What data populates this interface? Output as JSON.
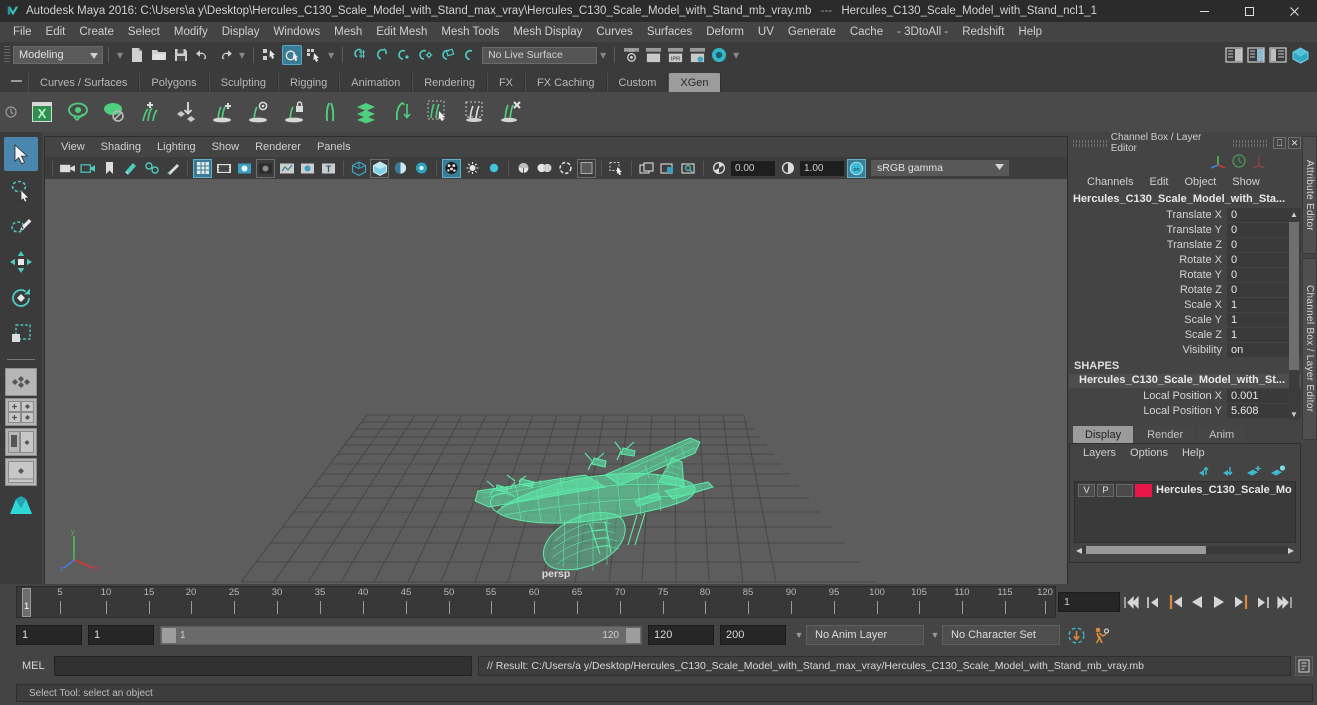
{
  "titlebar": {
    "app_title": "Autodesk Maya 2016: C:\\Users\\a y\\Desktop\\Hercules_C130_Scale_Model_with_Stand_max_vray\\Hercules_C130_Scale_Model_with_Stand_mb_vray.mb",
    "separator": "---",
    "selection_title": "Hercules_C130_Scale_Model_with_Stand_ncl1_1",
    "minimize": "─",
    "maximize": "❐",
    "close": "✕",
    "logo_icon": "maya-logo-icon"
  },
  "menubar": {
    "items": [
      "File",
      "Edit",
      "Create",
      "Select",
      "Modify",
      "Display",
      "Windows",
      "Mesh",
      "Edit Mesh",
      "Mesh Tools",
      "Mesh Display",
      "Curves",
      "Surfaces",
      "Deform",
      "UV",
      "Generate",
      "Cache",
      "- 3DtoAll -",
      "Redshift",
      "Help"
    ]
  },
  "statusbar": {
    "mode": "Modeling",
    "live_surface": "No Live Surface",
    "icons": [
      "new-scene-icon",
      "open-scene-icon",
      "save-scene-icon",
      "undo-icon",
      "redo-icon",
      "select-hierarchy-icon",
      "select-object-icon",
      "select-component-icon",
      "snap-to-grid-icon",
      "snap-to-curve-icon",
      "snap-to-point-icon",
      "snap-to-projected-center-icon",
      "snap-to-view-plane-icon",
      "make-live-icon"
    ],
    "right_icons": [
      "render-view-icon",
      "render-sequence-icon",
      "ipr-render-icon",
      "render-settings-icon",
      "hypershade-icon"
    ],
    "render_icons": [
      "render-current-frame-icon",
      "render-region-icon",
      "ipr-icon",
      "render-settings-icon",
      "toggle-icon"
    ]
  },
  "shelf": {
    "tabs": [
      "Curves / Surfaces",
      "Polygons",
      "Sculpting",
      "Rigging",
      "Animation",
      "Rendering",
      "FX",
      "FX Caching",
      "Custom",
      "XGen"
    ],
    "active_tab": "XGen",
    "icons": [
      "xgen-editor-icon",
      "xgen-preview-icon",
      "xgen-disable-preview-icon",
      "xgen-add-description-icon",
      "xgen-import-icon",
      "xgen-add-primitive-icon",
      "xgen-preview-primitive-icon",
      "xgen-lock-icon",
      "xgen-groom-brush-icon",
      "xgen-layers-icon",
      "xgen-comb-icon",
      "xgen-select-guides-icon",
      "xgen-region-icon",
      "xgen-delete-icon"
    ]
  },
  "toolbox": {
    "tools": [
      {
        "name": "select-tool",
        "active": true
      },
      {
        "name": "lasso-select-tool",
        "active": false
      },
      {
        "name": "paint-select-tool",
        "active": false
      },
      {
        "name": "move-tool",
        "active": false
      },
      {
        "name": "rotate-tool",
        "active": false
      },
      {
        "name": "scale-tool",
        "active": false
      }
    ],
    "layout_icons": [
      "layout-single-perspective-icon",
      "layout-four-view-icon",
      "layout-outliner-persp-icon",
      "layout-persp-graph-icon",
      "layout-hypershade-icon"
    ]
  },
  "viewport": {
    "menus": [
      "View",
      "Shading",
      "Lighting",
      "Show",
      "Renderer",
      "Panels"
    ],
    "camera_label": "persp",
    "exposure": "0.00",
    "gamma": "1.00",
    "color_profile": "sRGB gamma",
    "color_mgmt_toggle": "on",
    "toolbar_icons": [
      "select-camera-icon",
      "lock-camera-icon",
      "bookmark-icon",
      "image-plane-icon",
      "2d-pan-zoom-icon",
      "grease-pencil-icon",
      "grid-toggle-icon",
      "film-gate-icon",
      "resolution-gate-icon",
      "gate-mask-icon",
      "xray-icon",
      "xray-joints-icon",
      "texture-border-icon",
      "wireframe-shaded-icon",
      "smooth-shaded-icon",
      "shaded-textured-icon",
      "lighting-icon",
      "shadows-icon",
      "ao-icon",
      "motion-blur-icon",
      "multisample-icon",
      "isolate-select-icon",
      "panel-tearoff-icon",
      "panel-copy-icon",
      "panel-search-icon"
    ]
  },
  "channel_box": {
    "title": "Channel Box / Layer Editor",
    "menus": [
      "Channels",
      "Edit",
      "Object",
      "Show"
    ],
    "object_name": "Hercules_C130_Scale_Model_with_Sta...",
    "attributes": [
      {
        "label": "Translate X",
        "value": "0"
      },
      {
        "label": "Translate Y",
        "value": "0"
      },
      {
        "label": "Translate Z",
        "value": "0"
      },
      {
        "label": "Rotate X",
        "value": "0"
      },
      {
        "label": "Rotate Y",
        "value": "0"
      },
      {
        "label": "Rotate Z",
        "value": "0"
      },
      {
        "label": "Scale X",
        "value": "1"
      },
      {
        "label": "Scale Y",
        "value": "1"
      },
      {
        "label": "Scale Z",
        "value": "1"
      },
      {
        "label": "Visibility",
        "value": "on"
      }
    ],
    "shapes_header": "SHAPES",
    "shape_name": "Hercules_C130_Scale_Model_with_St...",
    "shape_attributes": [
      {
        "label": "Local Position X",
        "value": "0.001"
      },
      {
        "label": "Local Position Y",
        "value": "5.608"
      }
    ]
  },
  "layer_editor": {
    "tabs": [
      "Display",
      "Render",
      "Anim"
    ],
    "active_tab": "Display",
    "menus": [
      "Layers",
      "Options",
      "Help"
    ],
    "tool_icons": [
      "layer-move-up-icon",
      "layer-move-down-icon",
      "layer-new-icon",
      "layer-new-from-selected-icon"
    ],
    "layers": [
      {
        "visibility": "V",
        "playback": "P",
        "third": "",
        "color": "#e8174b",
        "name": "Hercules_C130_Scale_Mo"
      }
    ]
  },
  "right_tabs": {
    "attribute_editor": "Attribute Editor",
    "channel_box": "Channel Box / Layer Editor"
  },
  "timeline": {
    "current_frame": "1",
    "start_tick": 1,
    "end_tick": 120,
    "tick_labels": [
      5,
      10,
      15,
      20,
      25,
      30,
      35,
      40,
      45,
      50,
      55,
      60,
      65,
      70,
      75,
      80,
      85,
      90,
      95,
      100,
      105,
      110,
      115,
      120
    ],
    "playback_frame_field": "1",
    "playback_buttons": [
      "go-to-start-icon",
      "step-back-keyframe-icon",
      "step-back-frame-icon",
      "play-backwards-icon",
      "play-forwards-icon",
      "step-forward-frame-icon",
      "step-forward-keyframe-icon",
      "go-to-end-icon"
    ]
  },
  "range_bar": {
    "anim_start": "1",
    "range_start": "1",
    "slider_min_label": "1",
    "slider_max_label": "120",
    "range_end": "120",
    "anim_end": "200",
    "anim_layer": "No Anim Layer",
    "character_set": "No Character Set",
    "auto_key_icon": "auto-keyframe-icon",
    "anim_prefs_icon": "animation-preferences-icon"
  },
  "command_line": {
    "language": "MEL",
    "input_value": "",
    "result": "// Result: C:/Users/a y/Desktop/Hercules_C130_Scale_Model_with_Stand_max_vray/Hercules_C130_Scale_Model_with_Stand_mb_vray.mb",
    "script_editor_icon": "script-editor-icon"
  },
  "help_line": {
    "text": "Select Tool: select an object"
  },
  "colors": {
    "accent_blue": "#4a86ad",
    "wireframe_green": "#5dedaa",
    "layer_red": "#e8174b",
    "panel_bg": "#444444",
    "viewport_bg": "#5d5d5d"
  }
}
